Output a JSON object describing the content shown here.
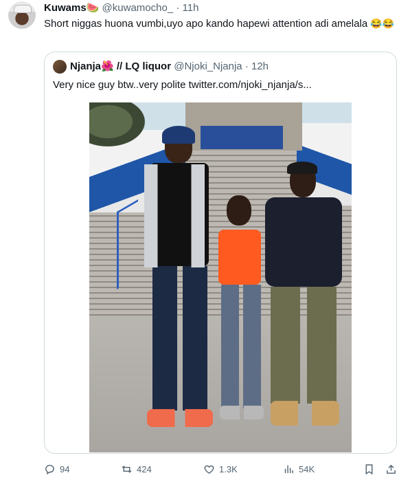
{
  "tweet": {
    "author_name": "Kuwams",
    "author_emoji": "🍉",
    "handle": "@kuwamocho_",
    "time": "11h",
    "text": "Short niggas huona vumbi,uyo apo kando hapewi attention adi amelala",
    "text_emoji": "😂😂"
  },
  "quote": {
    "author_name": "Njanja",
    "author_emoji": "🌺",
    "author_suffix": "// LQ liquor",
    "handle": "@Njoki_Njanja",
    "time": "12h",
    "text": "Very nice guy btw..very polite  twitter.com/njoki_njanja/s..."
  },
  "actions": {
    "replies": "94",
    "retweets": "424",
    "likes": "1.3K",
    "views": "54K"
  },
  "colors": {
    "text": "#0f1419",
    "muted": "#536471",
    "border": "#cfd9de"
  }
}
